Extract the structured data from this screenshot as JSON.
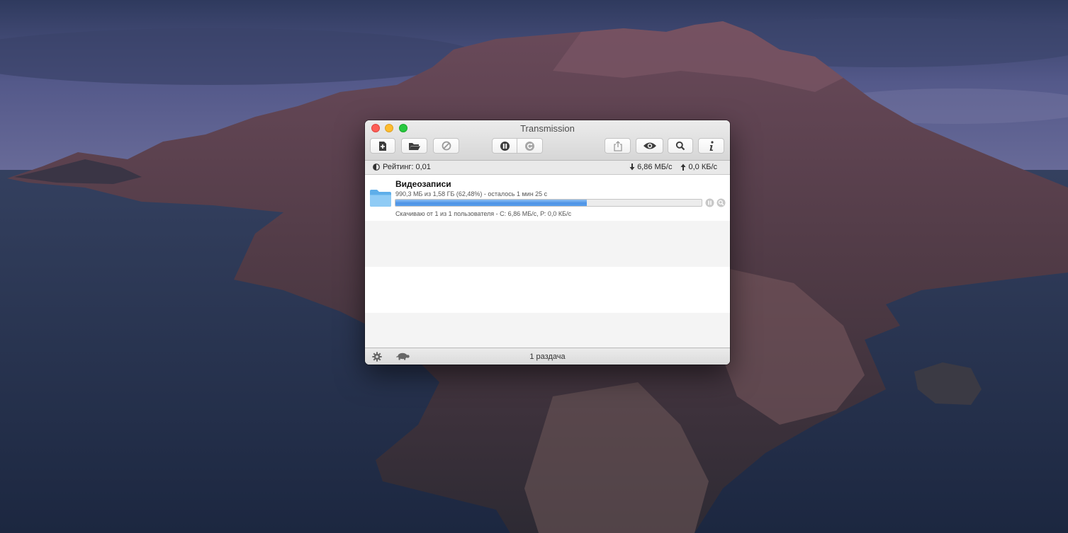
{
  "window": {
    "title": "Transmission"
  },
  "toolbar": {
    "buttons": [
      {
        "name": "create-torrent",
        "icon": "document-plus-icon"
      },
      {
        "name": "open-torrent",
        "icon": "folder-open-icon"
      },
      {
        "name": "remove-torrent",
        "icon": "no-entry-icon"
      },
      {
        "name": "pause-all",
        "icon": "pause-circle-icon"
      },
      {
        "name": "resume-all",
        "icon": "resume-circle-icon"
      },
      {
        "name": "share",
        "icon": "share-icon"
      },
      {
        "name": "quick-look",
        "icon": "eye-icon"
      },
      {
        "name": "filter",
        "icon": "magnifier-icon"
      },
      {
        "name": "inspector",
        "icon": "info-icon"
      }
    ]
  },
  "stats": {
    "ratio": "Рейтинг: 0,01",
    "download_rate": "6,86 МБ/с",
    "upload_rate": "0,0 КБ/с"
  },
  "torrents": [
    {
      "name": "Видеозаписи",
      "progress_text": "990,3 МБ из 1,58 ГБ (62,48%) - осталось 1 мин 25 с",
      "progress_percent": 62.48,
      "status_text": "Скачиваю от 1 из 1 пользователя - С: 6,86 МБ/с, Р: 0,0 КБ/с",
      "icon": "folder-icon"
    }
  ],
  "bottombar": {
    "count": "1 раздача"
  },
  "colors": {
    "progress_fill": "#4d93e6",
    "close": "#fe5f57",
    "minimize": "#febc2e",
    "maximize": "#28c840"
  }
}
